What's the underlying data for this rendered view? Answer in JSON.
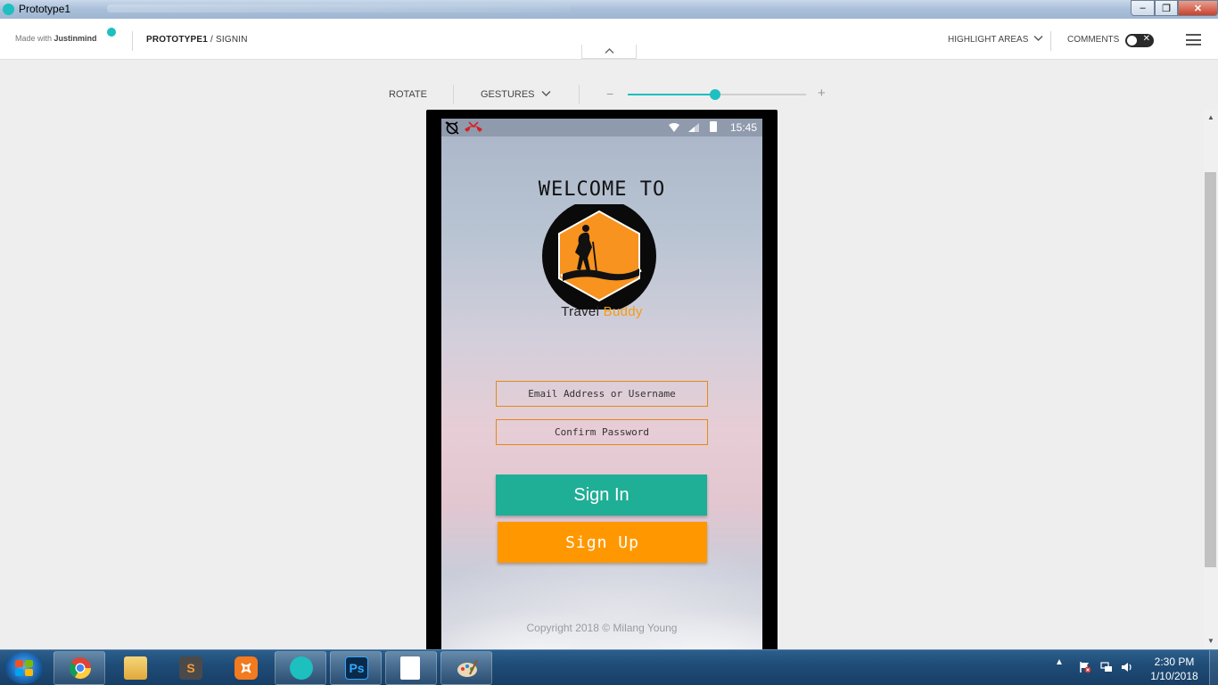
{
  "window": {
    "title": "Prototype1",
    "min": "–",
    "max": "❐",
    "close": "✕"
  },
  "appbar": {
    "made_with": "Made with",
    "brand": "Justinmind",
    "breadcrumb_project": "PROTOTYPE1",
    "breadcrumb_sep": " / ",
    "breadcrumb_page": "SIGNIN",
    "highlight_areas": "HIGHLIGHT AREAS",
    "comments": "COMMENTS",
    "comments_toggle_state": "off",
    "toggle_x": "✕"
  },
  "toolbar": {
    "rotate": "ROTATE",
    "gestures": "GESTURES",
    "zoom_minus": "−",
    "zoom_plus": "+",
    "zoom_level": 0.49
  },
  "phone": {
    "status_time": "15:45",
    "welcome": "WELCOME TO",
    "brand_travel": "Travel",
    "brand_buddy": "Buddy",
    "email_placeholder": "Email Address or Username",
    "password_placeholder": "Confirm Password",
    "signin_label": "Sign In",
    "signup_label": "Sign Up",
    "copyright": "Copyright 2018 © Milang Young"
  },
  "colors": {
    "accent": "#1dbfbf",
    "signin": "#1fae96",
    "signup": "#ff9800",
    "brand_orange": "#f39c12"
  },
  "taskbar": {
    "apps": [
      "chrome-icon",
      "file-explorer-icon",
      "sublime-text-icon",
      "xampp-icon",
      "justinmind-icon",
      "photoshop-icon",
      "blank-document-icon",
      "paint-icon"
    ],
    "ps_label": "Ps",
    "sublime_label": "S",
    "tray_arrow": "▲",
    "time": "2:30 PM",
    "date": "1/10/2018"
  }
}
